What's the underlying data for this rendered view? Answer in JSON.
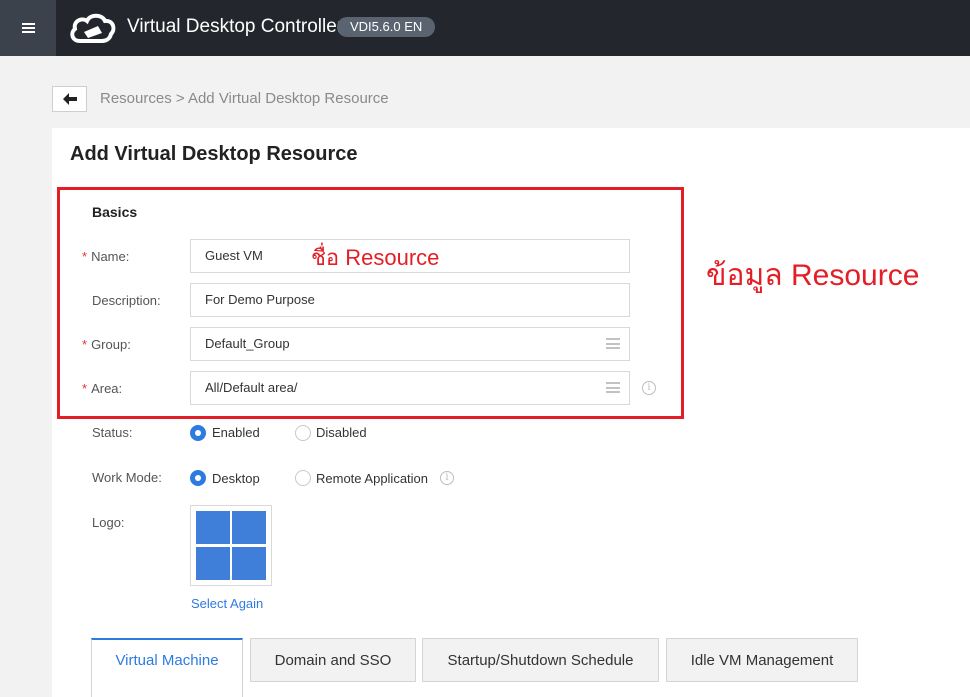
{
  "app": {
    "title": "Virtual Desktop Controller",
    "version": "VDI5.6.0 EN"
  },
  "breadcrumb": "Resources > Add Virtual Desktop Resource",
  "page_title": "Add Virtual Desktop Resource",
  "basics": {
    "section_title": "Basics",
    "name": {
      "label": "Name:",
      "value": "Guest VM"
    },
    "description": {
      "label": "Description:",
      "value": "For Demo Purpose"
    },
    "group": {
      "label": "Group:",
      "value": "Default_Group"
    },
    "area": {
      "label": "Area:",
      "value": "All/Default area/"
    }
  },
  "required_mark": "*",
  "status": {
    "label": "Status:",
    "options": [
      "Enabled",
      "Disabled"
    ],
    "selected": "Enabled"
  },
  "work_mode": {
    "label": "Work Mode:",
    "options": [
      "Desktop",
      "Remote Application"
    ],
    "selected": "Desktop"
  },
  "logo": {
    "label": "Logo:",
    "select_again": "Select Again"
  },
  "annotations": {
    "name_note": "ชื่อ Resource",
    "section_note": "ข้อมูล Resource",
    "color": "#e41e26"
  },
  "tabs": [
    "Virtual Machine",
    "Domain and SSO",
    "Startup/Shutdown Schedule",
    "Idle VM Management"
  ],
  "active_tab": "Virtual Machine",
  "colors": {
    "accent": "#2d7be0",
    "topbar": "#23272d",
    "required": "#e8322e"
  },
  "icons": [
    "menu-icon",
    "cloud-logo-icon",
    "back-arrow-icon",
    "list-icon",
    "info-icon",
    "windows-logo-icon"
  ]
}
